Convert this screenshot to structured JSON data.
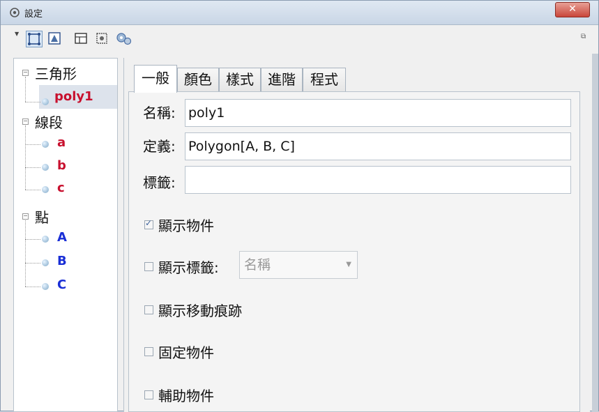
{
  "window": {
    "title": "設定"
  },
  "icons": {
    "app": "settings-gear-icon",
    "close": "close-icon",
    "toolbar_arrow": "dropdown-arrow-icon",
    "toolbar": [
      "basic-tools-icon",
      "graphics-icon",
      "layout-icon",
      "defaults-icon",
      "advanced-settings-icon"
    ],
    "restore": "restore-icon"
  },
  "tree": {
    "groups": [
      {
        "label": "三角形",
        "items": [
          {
            "label": "poly1",
            "color": "#c8102e",
            "selected": true
          }
        ]
      },
      {
        "label": "線段",
        "items": [
          {
            "label": "a",
            "color": "#c8102e"
          },
          {
            "label": "b",
            "color": "#c8102e"
          },
          {
            "label": "c",
            "color": "#c8102e"
          }
        ]
      },
      {
        "label": "點",
        "items": [
          {
            "label": "A",
            "color": "#1a2fd6"
          },
          {
            "label": "B",
            "color": "#1a2fd6"
          },
          {
            "label": "C",
            "color": "#1a2fd6"
          }
        ]
      }
    ]
  },
  "tabs": [
    "一般",
    "顏色",
    "樣式",
    "進階",
    "程式"
  ],
  "active_tab": "一般",
  "form": {
    "name_label": "名稱:",
    "name_value": "poly1",
    "definition_label": "定義:",
    "definition_value": "Polygon[A, B, C]",
    "caption_label": "標籤:",
    "caption_value": ""
  },
  "checkboxes": {
    "show_object": {
      "label": "顯示物件",
      "checked": true
    },
    "show_label": {
      "label": "顯示標籤:",
      "checked": false,
      "select_value": "名稱"
    },
    "show_trace": {
      "label": "顯示移動痕跡",
      "checked": false
    },
    "fix_object": {
      "label": "固定物件",
      "checked": false
    },
    "auxiliary": {
      "label": "輔助物件",
      "checked": false
    }
  }
}
